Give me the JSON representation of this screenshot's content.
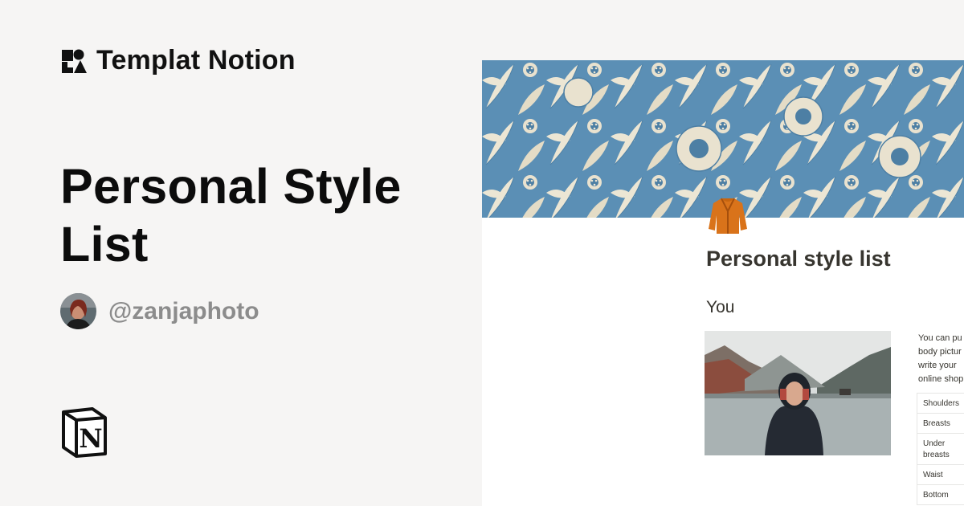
{
  "brand": {
    "name": "Templat Notion",
    "icon": "shapes-logo-icon"
  },
  "template": {
    "title": "Personal Style List"
  },
  "author": {
    "handle": "@zanjaphoto",
    "avatar": "author-avatar"
  },
  "platform": {
    "icon": "notion-logo-icon"
  },
  "preview": {
    "page_icon": "jacket-icon",
    "title": "Personal style list",
    "section_heading": "You",
    "intro_lines": [
      "You can pu",
      "body pictur",
      "write your",
      "online shop"
    ],
    "measurements": [
      "Shoulders",
      "Breasts",
      "Under breasts",
      "Waist",
      "Bottom"
    ],
    "colors": {
      "cover_blue": "#5b8fb5",
      "cover_cream": "#ece6d4",
      "icon_orange": "#d9731a"
    }
  }
}
